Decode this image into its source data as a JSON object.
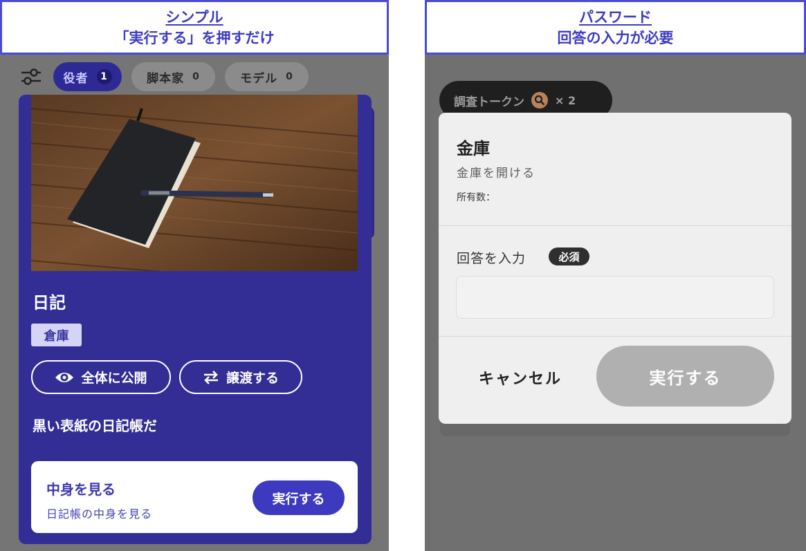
{
  "left_caption": {
    "line1": "シンプル",
    "line2": "「実行する」を押すだけ"
  },
  "right_caption": {
    "line1": "パスワード",
    "line2": "回答の入力が必要"
  },
  "filters": [
    {
      "label": "役者",
      "count": "1",
      "active": true
    },
    {
      "label": "脚本家",
      "count": "0",
      "active": false
    },
    {
      "label": "モデル",
      "count": "0",
      "active": false
    }
  ],
  "card": {
    "title": "日記",
    "tag": "倉庫",
    "public_button": "全体に公開",
    "transfer_button": "譲渡する",
    "description": "黒い表紙の日記帳だ",
    "action": {
      "title": "中身を見る",
      "subtitle": "日記帳の中身を見る",
      "button": "実行する"
    }
  },
  "token": {
    "label": "調査トークン",
    "multiplier": "× 2"
  },
  "dialog": {
    "title": "金庫",
    "subtitle": "金庫を開ける",
    "owned_label": "所有数：",
    "answer_label": "回答を入力",
    "required_badge": "必須",
    "input_value": "",
    "input_placeholder": "",
    "cancel_button": "キャンセル",
    "submit_button": "実行する"
  },
  "colors": {
    "accent": "#322e96",
    "caption_blue": "#3c3cc4",
    "disabled": "#b0b0b0"
  }
}
